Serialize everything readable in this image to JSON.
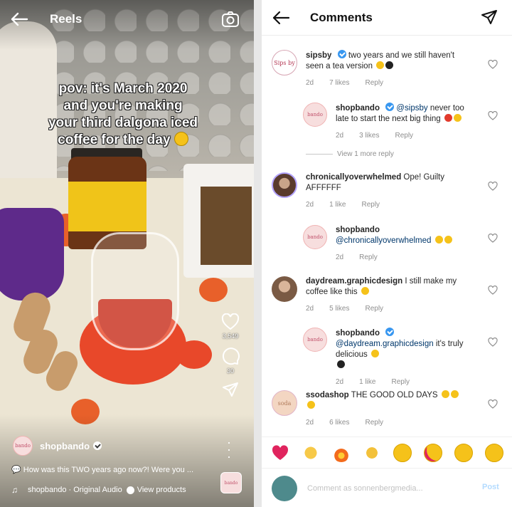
{
  "reel": {
    "header_title": "Reels",
    "overlay_lines": [
      "pov: it's March 2020",
      "and you're making",
      "your third dalgona iced",
      "coffee for the day"
    ],
    "likes_count": "3,549",
    "comments_count": "30",
    "author": "shopbando",
    "brand_avatar_text": "bando",
    "caption": "How was this TWO years ago now?! Were you ...",
    "audio_label": "shopbando · Original Audio",
    "view_products": "View products",
    "icons": [
      "back-arrow-icon",
      "camera-icon",
      "heart-icon",
      "comment-icon",
      "share-icon",
      "more-icon",
      "music-note-icon",
      "shopping-bag-icon"
    ]
  },
  "comments_panel": {
    "title": "Comments",
    "comments": [
      {
        "user": "sipsby",
        "avatar_text": "Sips by",
        "text": "two years and we still haven't seen a tea version",
        "time": "2d",
        "likes": "7 likes",
        "reply": "Reply"
      },
      {
        "user": "shopbando",
        "avatar_text": "bando",
        "mention": "@sipsby",
        "text": "never too late to start the next big thing",
        "time": "2d",
        "likes": "3 likes",
        "reply": "Reply"
      },
      {
        "user": "chronicallyoverwhelmed",
        "text": "Ope! Guilty AFFFFFF",
        "time": "2d",
        "likes": "1 like",
        "reply": "Reply"
      },
      {
        "user": "shopbando",
        "avatar_text": "bando",
        "mention": "@chronicallyoverwhelmed",
        "text": "",
        "time": "2d",
        "likes": "",
        "reply": "Reply"
      },
      {
        "user": "daydream.graphicdesign",
        "text": "I still make my coffee like this",
        "time": "2d",
        "likes": "5 likes",
        "reply": "Reply"
      },
      {
        "user": "shopbando",
        "avatar_text": "bando",
        "mention": "@daydream.graphicdesign",
        "text": "it's truly delicious",
        "time": "2d",
        "likes": "1 like",
        "reply": "Reply"
      },
      {
        "user": "ssodashop",
        "avatar_text": "soda",
        "text": "THE GOOD OLD DAYS",
        "time": "2d",
        "likes": "6 likes",
        "reply": "Reply"
      }
    ],
    "view_more": "View 1 more reply",
    "input_placeholder": "Comment as sonnenbergmedia...",
    "post_label": "Post",
    "reaction_emojis": [
      "red-heart",
      "raised-hands",
      "fire",
      "clapping-hands",
      "crying-face",
      "heart-eyes-face",
      "astonished-face",
      "laughing-face"
    ]
  },
  "colors": {
    "link": "#00376b",
    "verified": "#3897f0",
    "meta": "#8e8e8e",
    "post_disabled": "#b3dbff"
  }
}
